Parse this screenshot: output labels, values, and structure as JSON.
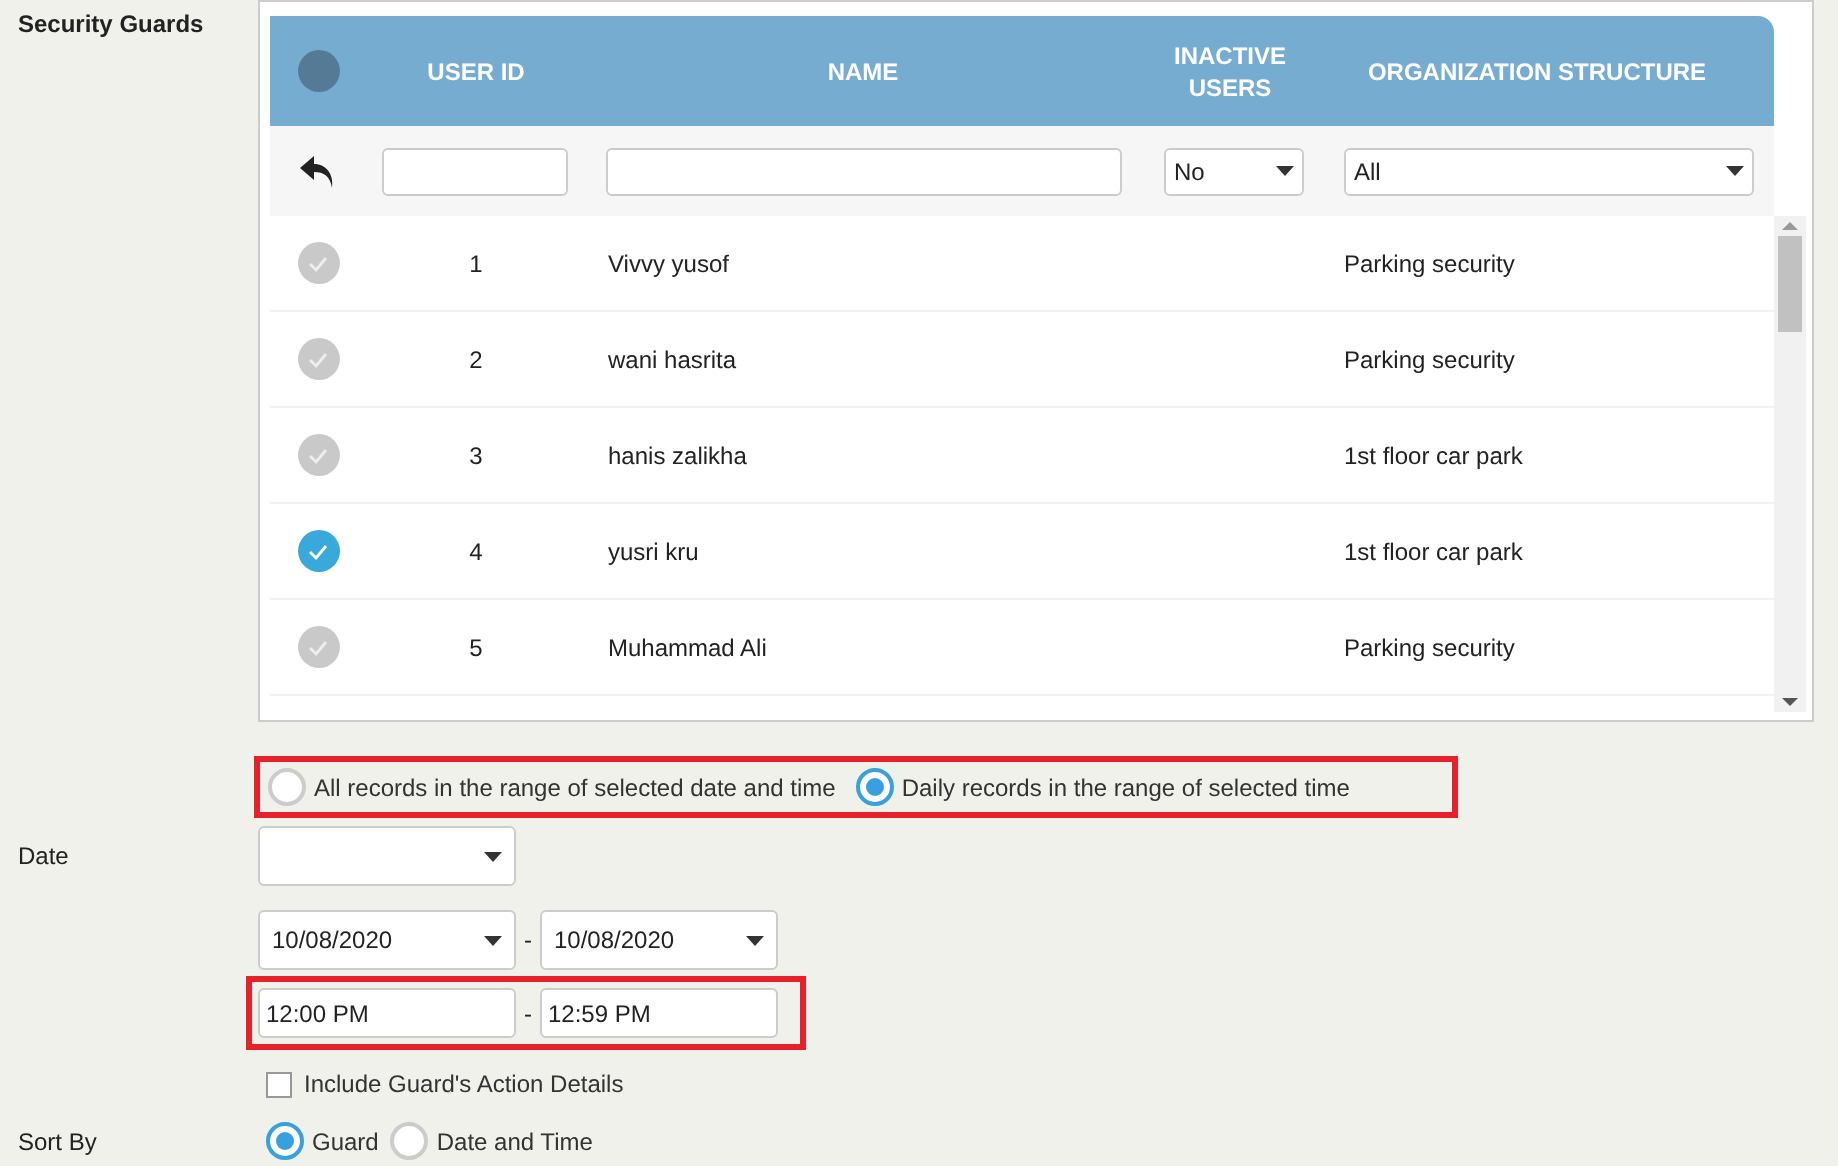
{
  "section_label": "Security Guards",
  "table": {
    "select_all": {
      "checked": false
    },
    "columns": [
      "USER ID",
      "NAME",
      "INACTIVE USERS",
      "ORGANIZATION STRUCTURE"
    ],
    "filters": {
      "inactive_users": "No",
      "organization_structure": "All"
    },
    "rows": [
      {
        "user_id": "1",
        "name": "Vivvy yusof",
        "organization_structure": "Parking security",
        "checked": false
      },
      {
        "user_id": "2",
        "name": "wani hasrita",
        "organization_structure": "Parking security",
        "checked": false
      },
      {
        "user_id": "3",
        "name": "hanis zalikha",
        "organization_structure": "1st floor car park",
        "checked": false
      },
      {
        "user_id": "4",
        "name": "yusri kru",
        "organization_structure": "1st floor car park",
        "checked": true
      },
      {
        "user_id": "5",
        "name": "Muhammad Ali",
        "organization_structure": "Parking security",
        "checked": false
      }
    ]
  },
  "record_mode": [
    {
      "label": "All records in the range of selected date and time",
      "selected": false
    },
    {
      "label": "Daily records in the range of selected time",
      "selected": true
    }
  ],
  "date": {
    "label": "Date"
  },
  "date_range": {
    "from": "10/08/2020",
    "separator": "-",
    "to": "10/08/2020"
  },
  "time_range": {
    "from": "12:00 PM",
    "separator": "-",
    "to": "12:59 PM"
  },
  "include_action_details": {
    "label": "Include Guard's Action Details",
    "checked": false
  },
  "sort_by": {
    "label": "Sort By",
    "options": [
      {
        "label": "Guard",
        "selected": true
      },
      {
        "label": "Date and Time",
        "selected": false
      }
    ]
  }
}
